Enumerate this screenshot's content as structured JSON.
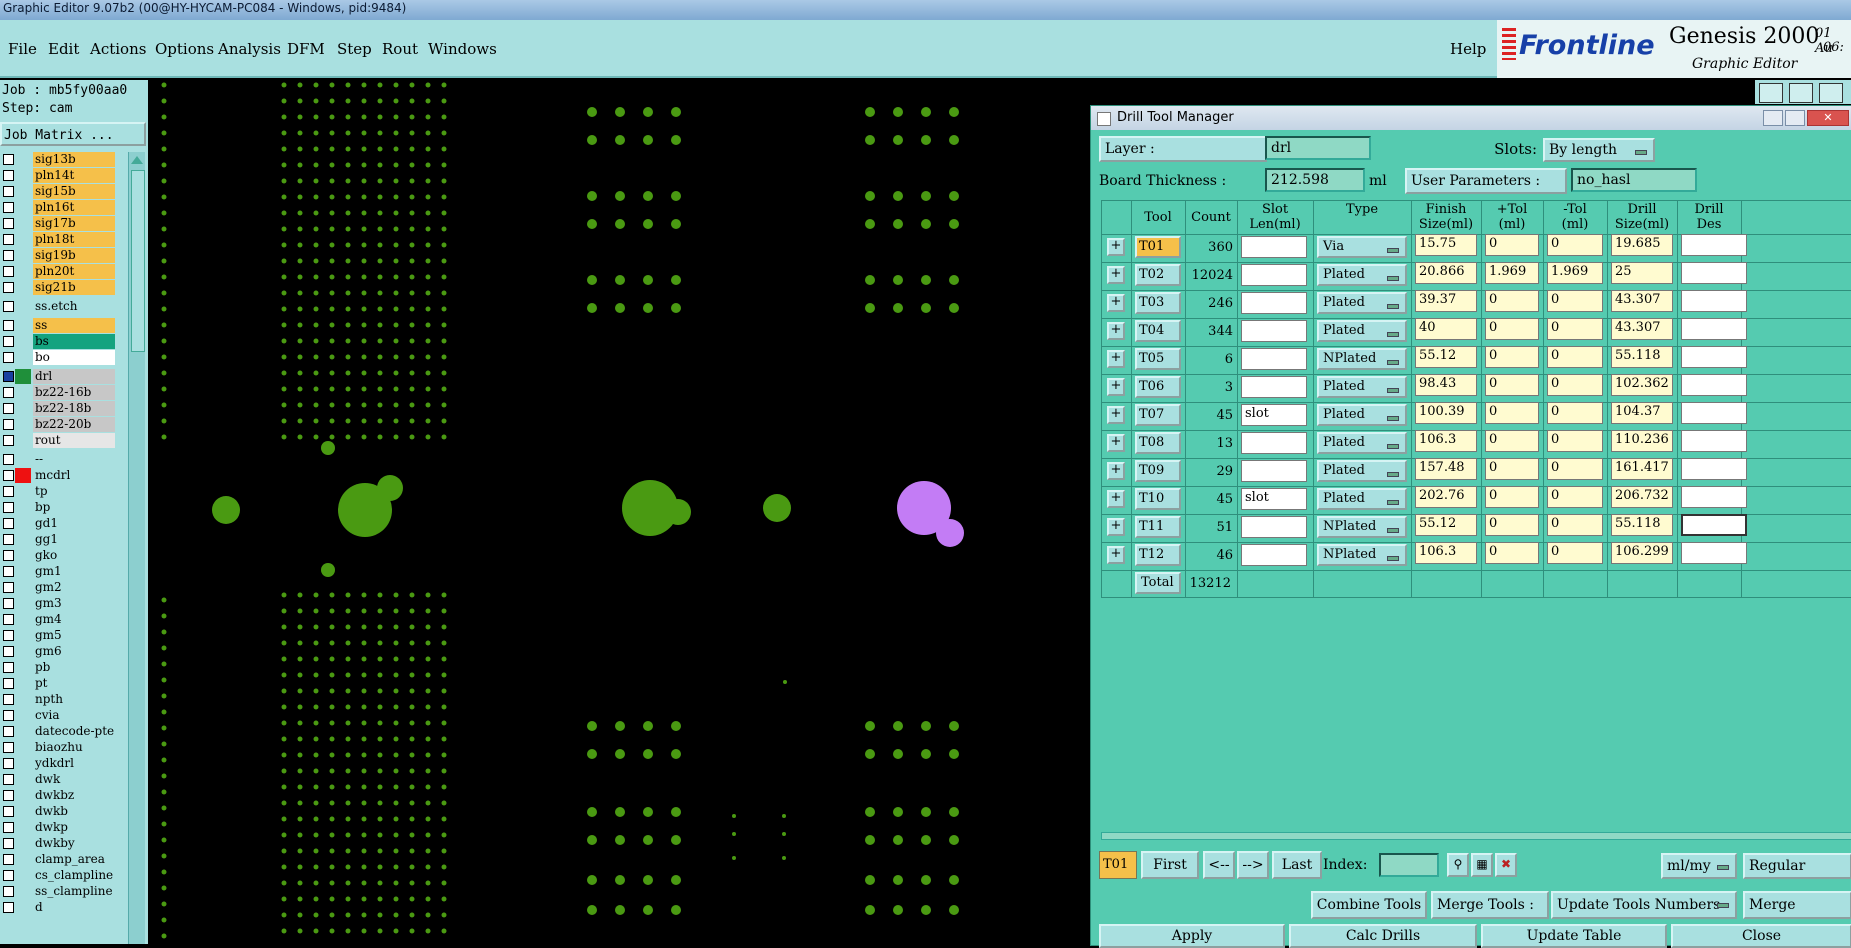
{
  "window_title": "Graphic Editor 9.07b2 (00@HY-HYCAM-PC084 - Windows, pid:9484)",
  "menu": [
    "File",
    "Edit",
    "Actions",
    "Options",
    "Analysis",
    "DFM",
    "Step",
    "Rout",
    "Windows"
  ],
  "help": "Help",
  "logo": {
    "brand": "Frontline",
    "product": "Genesis 2000",
    "subtitle": "Graphic Editor",
    "date": "01 Au",
    "time": "06:"
  },
  "job": "Job : mb5fy00aa0",
  "step": "Step: cam",
  "job_matrix": "Job Matrix ...",
  "layers": [
    {
      "name": "sig13b",
      "color": "#f5c04a"
    },
    {
      "name": "pln14t",
      "color": "#f5c04a"
    },
    {
      "name": "sig15b",
      "color": "#f5c04a"
    },
    {
      "name": "pln16t",
      "color": "#f5c04a"
    },
    {
      "name": "sig17b",
      "color": "#f5c04a"
    },
    {
      "name": "pln18t",
      "color": "#f5c04a"
    },
    {
      "name": "sig19b",
      "color": "#f5c04a"
    },
    {
      "name": "pln20t",
      "color": "#f5c04a"
    },
    {
      "name": "sig21b",
      "color": "#f5c04a"
    },
    {
      "name": "ss.etch",
      "color": "#a9e0e0"
    },
    {
      "name": "ss",
      "color": "#f5c04a"
    },
    {
      "name": "bs",
      "color": "#14a37f"
    },
    {
      "name": "bo",
      "color": "#ffffff"
    },
    {
      "name": "drl",
      "color": "#c7c7c7"
    },
    {
      "name": "bz22-16b",
      "color": "#c7c7c7"
    },
    {
      "name": "bz22-18b",
      "color": "#c7c7c7"
    },
    {
      "name": "bz22-20b",
      "color": "#c7c7c7"
    },
    {
      "name": "rout",
      "color": "#e6e6e6"
    },
    {
      "name": "--",
      "color": "#a9e0e0"
    },
    {
      "name": "mcdrl",
      "color": "#a9e0e0"
    },
    {
      "name": "tp",
      "color": "#a9e0e0"
    },
    {
      "name": "bp",
      "color": "#a9e0e0"
    },
    {
      "name": "gd1",
      "color": "#a9e0e0"
    },
    {
      "name": "gg1",
      "color": "#a9e0e0"
    },
    {
      "name": "gko",
      "color": "#a9e0e0"
    },
    {
      "name": "gm1",
      "color": "#a9e0e0"
    },
    {
      "name": "gm2",
      "color": "#a9e0e0"
    },
    {
      "name": "gm3",
      "color": "#a9e0e0"
    },
    {
      "name": "gm4",
      "color": "#a9e0e0"
    },
    {
      "name": "gm5",
      "color": "#a9e0e0"
    },
    {
      "name": "gm6",
      "color": "#a9e0e0"
    },
    {
      "name": "pb",
      "color": "#a9e0e0"
    },
    {
      "name": "pt",
      "color": "#a9e0e0"
    },
    {
      "name": "npth",
      "color": "#a9e0e0"
    },
    {
      "name": "cvia",
      "color": "#a9e0e0"
    },
    {
      "name": "datecode-pte",
      "color": "#a9e0e0"
    },
    {
      "name": "biaozhu",
      "color": "#a9e0e0"
    },
    {
      "name": "ydkdrl",
      "color": "#a9e0e0"
    },
    {
      "name": "dwk",
      "color": "#a9e0e0"
    },
    {
      "name": "dwkbz",
      "color": "#a9e0e0"
    },
    {
      "name": "dwkb",
      "color": "#a9e0e0"
    },
    {
      "name": "dwkp",
      "color": "#a9e0e0"
    },
    {
      "name": "dwkby",
      "color": "#a9e0e0"
    },
    {
      "name": "clamp_area",
      "color": "#a9e0e0"
    },
    {
      "name": "cs_clampline",
      "color": "#a9e0e0"
    },
    {
      "name": "ss_clampline",
      "color": "#a9e0e0"
    },
    {
      "name": "d",
      "color": "#a9e0e0"
    }
  ],
  "dialog": {
    "title": "Drill Tool Manager",
    "layer_label": "Layer          :",
    "layer_value": "drl",
    "slots_label": "Slots:",
    "slots_value": "By length",
    "thickness_label": "Board Thickness :",
    "thickness_value": "212.598",
    "thickness_unit": "ml",
    "user_params_label": "User Parameters :",
    "user_params_value": "no_hasl",
    "headers": [
      "Tool",
      "Count",
      "Slot\nLen(ml)",
      "Type",
      "Finish\nSize(ml)",
      "+Tol\n(ml)",
      "-Tol\n(ml)",
      "Drill\nSize(ml)",
      "Drill\nDes"
    ],
    "rows": [
      {
        "tool": "T01",
        "count": "360",
        "slot": "",
        "type": "Via",
        "finish": "15.75",
        "ptol": "0",
        "mtol": "0",
        "drill": "19.685",
        "des": ""
      },
      {
        "tool": "T02",
        "count": "12024",
        "slot": "",
        "type": "Plated",
        "finish": "20.866",
        "ptol": "1.969",
        "mtol": "1.969",
        "drill": "25",
        "des": ""
      },
      {
        "tool": "T03",
        "count": "246",
        "slot": "",
        "type": "Plated",
        "finish": "39.37",
        "ptol": "0",
        "mtol": "0",
        "drill": "43.307",
        "des": ""
      },
      {
        "tool": "T04",
        "count": "344",
        "slot": "",
        "type": "Plated",
        "finish": "40",
        "ptol": "0",
        "mtol": "0",
        "drill": "43.307",
        "des": ""
      },
      {
        "tool": "T05",
        "count": "6",
        "slot": "",
        "type": "NPlated",
        "finish": "55.12",
        "ptol": "0",
        "mtol": "0",
        "drill": "55.118",
        "des": ""
      },
      {
        "tool": "T06",
        "count": "3",
        "slot": "",
        "type": "Plated",
        "finish": "98.43",
        "ptol": "0",
        "mtol": "0",
        "drill": "102.362",
        "des": ""
      },
      {
        "tool": "T07",
        "count": "45",
        "slot": "slot",
        "type": "Plated",
        "finish": "100.39",
        "ptol": "0",
        "mtol": "0",
        "drill": "104.37",
        "des": ""
      },
      {
        "tool": "T08",
        "count": "13",
        "slot": "",
        "type": "Plated",
        "finish": "106.3",
        "ptol": "0",
        "mtol": "0",
        "drill": "110.236",
        "des": ""
      },
      {
        "tool": "T09",
        "count": "29",
        "slot": "",
        "type": "Plated",
        "finish": "157.48",
        "ptol": "0",
        "mtol": "0",
        "drill": "161.417",
        "des": ""
      },
      {
        "tool": "T10",
        "count": "45",
        "slot": "slot",
        "type": "Plated",
        "finish": "202.76",
        "ptol": "0",
        "mtol": "0",
        "drill": "206.732",
        "des": ""
      },
      {
        "tool": "T11",
        "count": "51",
        "slot": "",
        "type": "NPlated",
        "finish": "55.12",
        "ptol": "0",
        "mtol": "0",
        "drill": "55.118",
        "des": ""
      },
      {
        "tool": "T12",
        "count": "46",
        "slot": "",
        "type": "NPlated",
        "finish": "106.3",
        "ptol": "0",
        "mtol": "0",
        "drill": "106.299",
        "des": ""
      }
    ],
    "total_label": "Total",
    "total_value": "13212",
    "current_tool": "T01",
    "nav": {
      "first": "First",
      "prev": "<--",
      "next": "-->",
      "last": "Last",
      "index": "Index:"
    },
    "units": "ml/my",
    "mode": "Regular",
    "combine": "Combine Tools",
    "merge_label": "Merge Tools :",
    "update_numbers": "Update Tools Numbers",
    "merge": "Merge",
    "apply": "Apply",
    "calc": "Calc Drills",
    "update_table": "Update Table",
    "close": "Close"
  }
}
